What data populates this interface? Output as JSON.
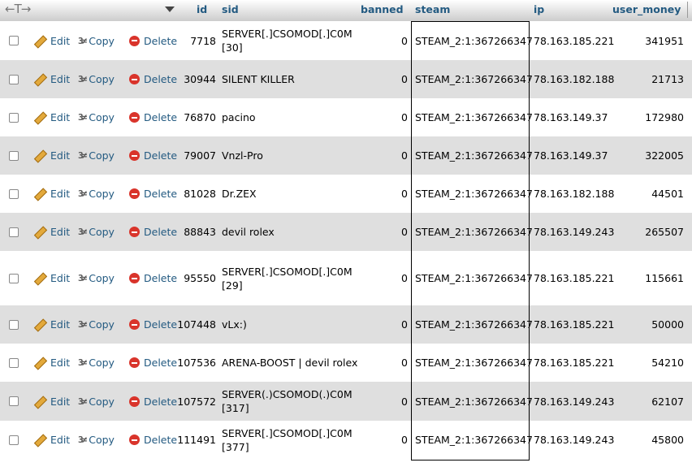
{
  "header": {
    "columns": [
      "id",
      "sid",
      "banned",
      "steam",
      "ip",
      "user_money"
    ],
    "arrows": "←T→"
  },
  "actions": {
    "edit": "Edit",
    "copy": "Copy",
    "delete": "Delete"
  },
  "rows": [
    {
      "id": "7718",
      "sid_line1": "SERVER[.]CSOMOD[.]C0M",
      "sid_line2": "[30]",
      "banned": "0",
      "steam": "STEAM_2:1:367266347",
      "ip": "78.163.185.221",
      "money": "341951"
    },
    {
      "id": "30944",
      "sid_line1": "SILENT KILLER",
      "sid_line2": "",
      "banned": "0",
      "steam": "STEAM_2:1:367266347",
      "ip": "78.163.182.188",
      "money": "21713"
    },
    {
      "id": "76870",
      "sid_line1": "pacino",
      "sid_line2": "",
      "banned": "0",
      "steam": "STEAM_2:1:367266347",
      "ip": "78.163.149.37",
      "money": "172980"
    },
    {
      "id": "79007",
      "sid_line1": "Vnzl-Pro",
      "sid_line2": "",
      "banned": "0",
      "steam": "STEAM_2:1:367266347",
      "ip": "78.163.149.37",
      "money": "322005"
    },
    {
      "id": "81028",
      "sid_line1": "Dr.ZEX",
      "sid_line2": "",
      "banned": "0",
      "steam": "STEAM_2:1:367266347",
      "ip": "78.163.182.188",
      "money": "44501"
    },
    {
      "id": "88843",
      "sid_line1": "devil rolex",
      "sid_line2": "",
      "banned": "0",
      "steam": "STEAM_2:1:367266347",
      "ip": "78.163.149.243",
      "money": "265507"
    },
    {
      "id": "95550",
      "sid_line1": "SERVER[.]CSOMOD[.]C0M",
      "sid_line2": "[29]",
      "banned": "0",
      "steam": "STEAM_2:1:367266347",
      "ip": "78.163.185.221",
      "money": "115661"
    },
    {
      "id": "107448",
      "sid_line1": "vLx:)",
      "sid_line2": "",
      "banned": "0",
      "steam": "STEAM_2:1:367266347",
      "ip": "78.163.185.221",
      "money": "50000"
    },
    {
      "id": "107536",
      "sid_line1": "ARENA-BOOST | devil rolex",
      "sid_line2": "",
      "banned": "0",
      "steam": "STEAM_2:1:367266347",
      "ip": "78.163.185.221",
      "money": "54210"
    },
    {
      "id": "107572",
      "sid_line1": "SERVER(.)CSOMOD(.)C0M",
      "sid_line2": "[317]",
      "banned": "0",
      "steam": "STEAM_2:1:367266347",
      "ip": "78.163.149.243",
      "money": "62107"
    },
    {
      "id": "111491",
      "sid_line1": "SERVER[.]CSOMOD[.]C0M",
      "sid_line2": "[377]",
      "banned": "0",
      "steam": "STEAM_2:1:367266347",
      "ip": "78.163.149.243",
      "money": "45800"
    }
  ]
}
